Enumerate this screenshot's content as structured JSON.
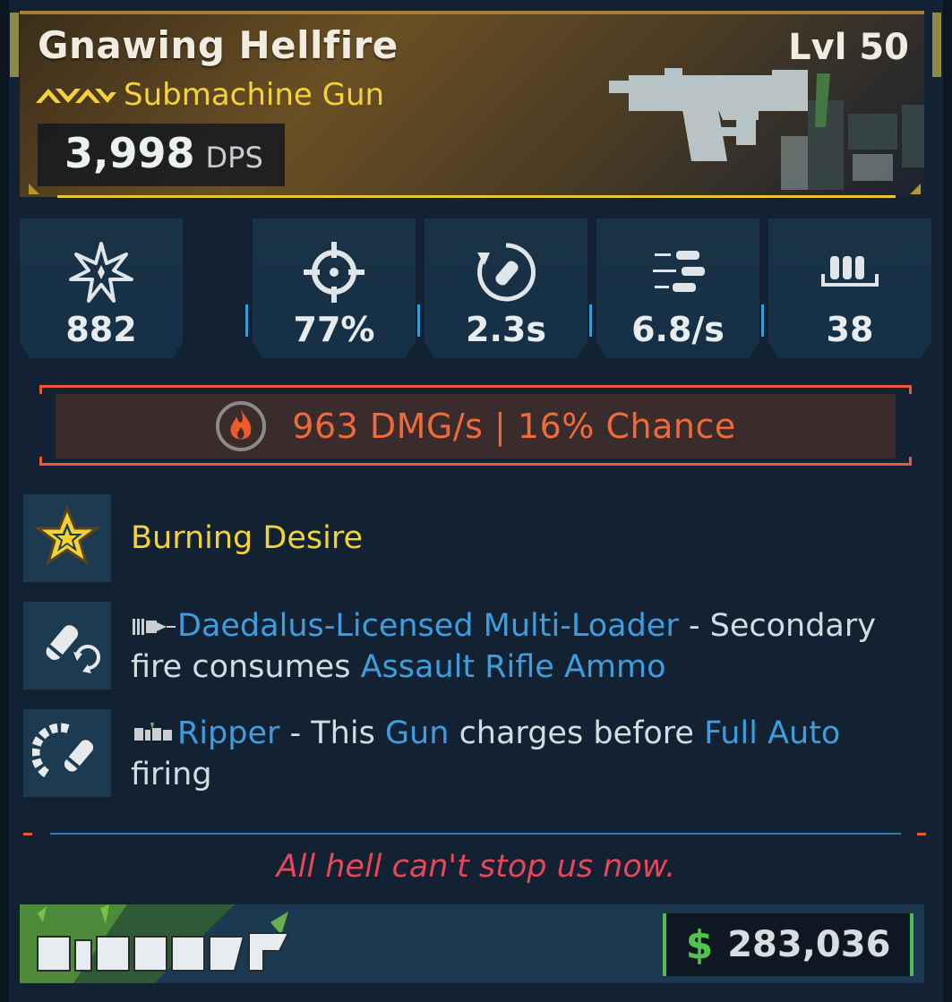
{
  "weapon": {
    "name": "Gnawing Hellfire",
    "type": "Submachine Gun",
    "level": "Lvl 50",
    "dps_value": "3,998",
    "dps_label": "DPS",
    "rarity_color": "#f5d23a"
  },
  "stats": [
    {
      "icon": "damage-burst-icon",
      "value": "882"
    },
    {
      "icon": "crosshair-icon",
      "value": "77%"
    },
    {
      "icon": "reload-icon",
      "value": "2.3s"
    },
    {
      "icon": "fire-rate-icon",
      "value": "6.8/s"
    },
    {
      "icon": "magazine-icon",
      "value": "38"
    }
  ],
  "element": {
    "icon": "fire-icon",
    "text": "963 DMG/s | 16% Chance",
    "color": "#ef6a3a"
  },
  "perks": {
    "red_text": {
      "icon": "star-badge-icon",
      "title": "Burning Desire"
    },
    "perk1": {
      "icon": "bullet-reload-icon",
      "name": "Daedalus-Licensed Multi-Loader",
      "text_a": " - Secondary fire consumes ",
      "highlight": "Assault Rifle Ammo"
    },
    "perk2": {
      "icon": "ripper-charge-icon",
      "name": "Ripper",
      "text_a": " - This ",
      "highlight_a": "Gun",
      "text_b": " charges before ",
      "highlight_b": "Full Auto",
      "text_c": " firing"
    }
  },
  "flavor": "All hell can't stop us now.",
  "footer": {
    "brand_logo": "ripper-logo",
    "currency_symbol": "$",
    "price": "283,036"
  }
}
